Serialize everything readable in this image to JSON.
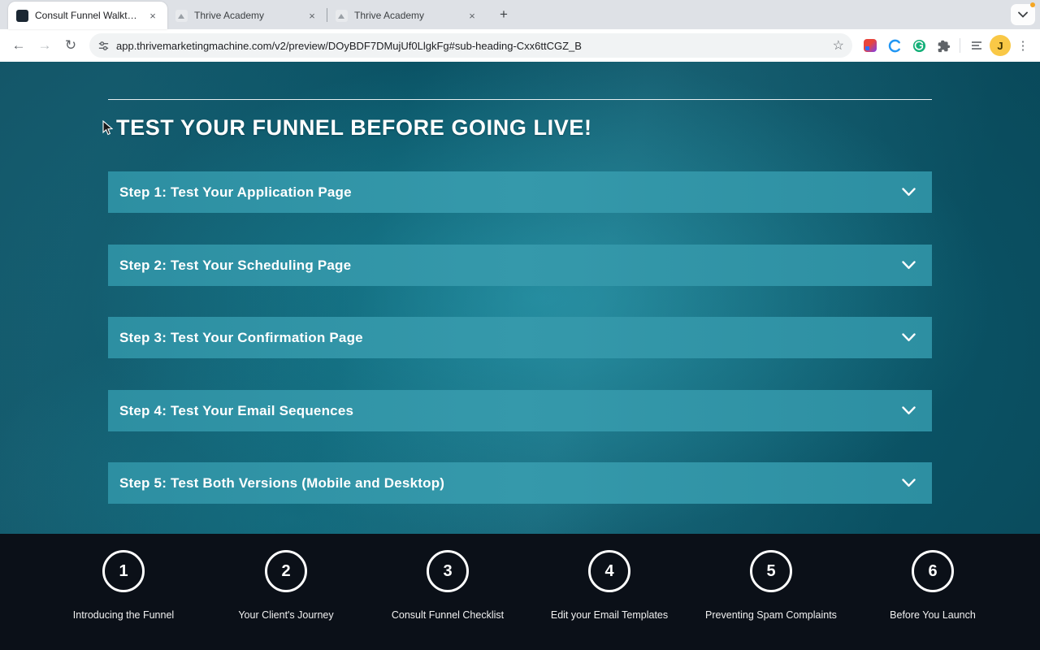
{
  "browser": {
    "tabs": [
      {
        "title": "Consult Funnel Walkthrough |",
        "active": true
      },
      {
        "title": "Thrive Academy",
        "active": false
      },
      {
        "title": "Thrive Academy",
        "active": false
      }
    ],
    "glyphs": {
      "close": "×",
      "new_tab": "+",
      "back": "←",
      "forward": "→",
      "reload": "↻",
      "star": "☆",
      "kebab": "⋮"
    },
    "url": "app.thrivemarketingmachine.com/v2/preview/DOyBDF7DMujUf0LlgkFg#sub-heading-Cxx6ttCGZ_B",
    "avatar_initial": "J"
  },
  "page": {
    "heading": "TEST YOUR FUNNEL BEFORE GOING LIVE!",
    "accordions": [
      {
        "label": "Step 1: Test Your Application Page"
      },
      {
        "label": "Step 2: Test Your Scheduling Page"
      },
      {
        "label": "Step 3: Test Your Confirmation Page"
      },
      {
        "label": "Step 4: Test Your Email Sequences"
      },
      {
        "label": "Step 5: Test Both Versions (Mobile and Desktop)"
      }
    ],
    "footer_steps": [
      {
        "number": "1",
        "label": "Introducing the Funnel"
      },
      {
        "number": "2",
        "label": "Your Client's Journey"
      },
      {
        "number": "3",
        "label": "Consult Funnel Checklist"
      },
      {
        "number": "4",
        "label": "Edit your Email Templates"
      },
      {
        "number": "5",
        "label": "Preventing Spam Complaints"
      },
      {
        "number": "6",
        "label": "Before You Launch"
      }
    ]
  },
  "colors": {
    "accent_teal": "#3599ab",
    "page_bg_dark": "#083c4d",
    "footer_bg": "#0b1018",
    "avatar_bg": "#f9c846",
    "record_dot": "#f5a623"
  }
}
